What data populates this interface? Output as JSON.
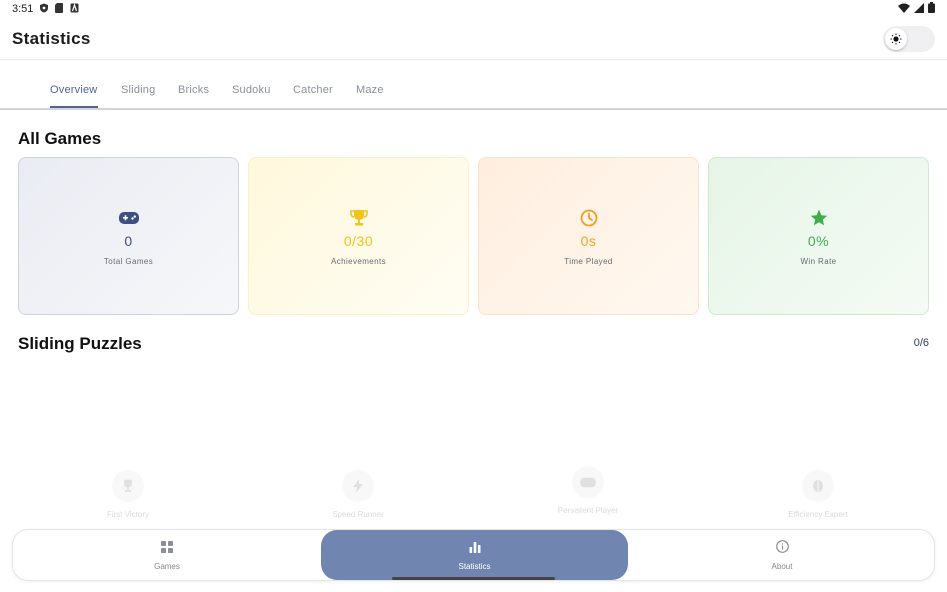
{
  "status_bar": {
    "time": "3:51"
  },
  "app": {
    "title": "Statistics"
  },
  "tabs": [
    {
      "label": "Overview",
      "active": true
    },
    {
      "label": "Sliding",
      "active": false
    },
    {
      "label": "Bricks",
      "active": false
    },
    {
      "label": "Sudoku",
      "active": false
    },
    {
      "label": "Catcher",
      "active": false
    },
    {
      "label": "Maze",
      "active": false
    }
  ],
  "all_games": {
    "title": "All Games",
    "cards": [
      {
        "value": "0",
        "label": "Total Games",
        "icon": "gamepad-icon",
        "color": "#3f4f83"
      },
      {
        "value": "0/30",
        "label": "Achievements",
        "icon": "trophy-icon",
        "color": "#f0c419"
      },
      {
        "value": "0s",
        "label": "Time Played",
        "icon": "clock-icon",
        "color": "#f0a020"
      },
      {
        "value": "0%",
        "label": "Win Rate",
        "icon": "star-icon",
        "color": "#3fae4a"
      }
    ]
  },
  "sliding_puzzles": {
    "title": "Sliding Puzzles",
    "progress": "0/6",
    "achievements": [
      {
        "label": "First Victory",
        "icon": "trophy-icon"
      },
      {
        "label": "Speed Runner",
        "icon": "bolt-icon"
      },
      {
        "label": "Persistent Player",
        "icon": "gamepad-icon"
      },
      {
        "label": "Efficiency Expert",
        "icon": "brain-icon"
      }
    ]
  },
  "bottom_nav": {
    "items": [
      {
        "label": "Games",
        "icon": "grid-icon"
      },
      {
        "label": "Statistics",
        "icon": "bar-chart-icon",
        "active": true
      },
      {
        "label": "About",
        "icon": "info-icon"
      }
    ]
  },
  "colors": {
    "accent": "#51658f",
    "nav_active": "#7086b0"
  }
}
